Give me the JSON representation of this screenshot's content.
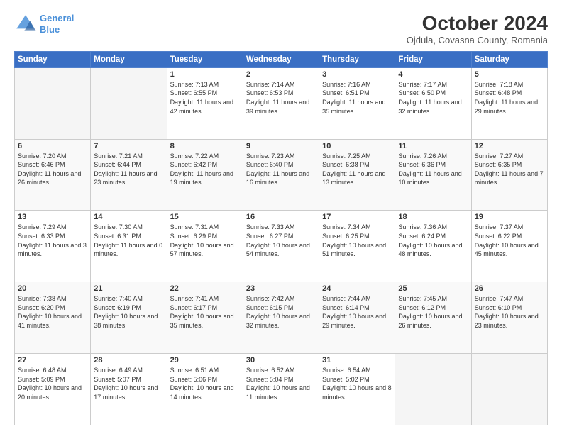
{
  "header": {
    "logo_line1": "General",
    "logo_line2": "Blue",
    "title": "October 2024",
    "subtitle": "Ojdula, Covasna County, Romania"
  },
  "days_of_week": [
    "Sunday",
    "Monday",
    "Tuesday",
    "Wednesday",
    "Thursday",
    "Friday",
    "Saturday"
  ],
  "weeks": [
    [
      {
        "day": "",
        "info": ""
      },
      {
        "day": "",
        "info": ""
      },
      {
        "day": "1",
        "info": "Sunrise: 7:13 AM\nSunset: 6:55 PM\nDaylight: 11 hours and 42 minutes."
      },
      {
        "day": "2",
        "info": "Sunrise: 7:14 AM\nSunset: 6:53 PM\nDaylight: 11 hours and 39 minutes."
      },
      {
        "day": "3",
        "info": "Sunrise: 7:16 AM\nSunset: 6:51 PM\nDaylight: 11 hours and 35 minutes."
      },
      {
        "day": "4",
        "info": "Sunrise: 7:17 AM\nSunset: 6:50 PM\nDaylight: 11 hours and 32 minutes."
      },
      {
        "day": "5",
        "info": "Sunrise: 7:18 AM\nSunset: 6:48 PM\nDaylight: 11 hours and 29 minutes."
      }
    ],
    [
      {
        "day": "6",
        "info": "Sunrise: 7:20 AM\nSunset: 6:46 PM\nDaylight: 11 hours and 26 minutes."
      },
      {
        "day": "7",
        "info": "Sunrise: 7:21 AM\nSunset: 6:44 PM\nDaylight: 11 hours and 23 minutes."
      },
      {
        "day": "8",
        "info": "Sunrise: 7:22 AM\nSunset: 6:42 PM\nDaylight: 11 hours and 19 minutes."
      },
      {
        "day": "9",
        "info": "Sunrise: 7:23 AM\nSunset: 6:40 PM\nDaylight: 11 hours and 16 minutes."
      },
      {
        "day": "10",
        "info": "Sunrise: 7:25 AM\nSunset: 6:38 PM\nDaylight: 11 hours and 13 minutes."
      },
      {
        "day": "11",
        "info": "Sunrise: 7:26 AM\nSunset: 6:36 PM\nDaylight: 11 hours and 10 minutes."
      },
      {
        "day": "12",
        "info": "Sunrise: 7:27 AM\nSunset: 6:35 PM\nDaylight: 11 hours and 7 minutes."
      }
    ],
    [
      {
        "day": "13",
        "info": "Sunrise: 7:29 AM\nSunset: 6:33 PM\nDaylight: 11 hours and 3 minutes."
      },
      {
        "day": "14",
        "info": "Sunrise: 7:30 AM\nSunset: 6:31 PM\nDaylight: 11 hours and 0 minutes."
      },
      {
        "day": "15",
        "info": "Sunrise: 7:31 AM\nSunset: 6:29 PM\nDaylight: 10 hours and 57 minutes."
      },
      {
        "day": "16",
        "info": "Sunrise: 7:33 AM\nSunset: 6:27 PM\nDaylight: 10 hours and 54 minutes."
      },
      {
        "day": "17",
        "info": "Sunrise: 7:34 AM\nSunset: 6:25 PM\nDaylight: 10 hours and 51 minutes."
      },
      {
        "day": "18",
        "info": "Sunrise: 7:36 AM\nSunset: 6:24 PM\nDaylight: 10 hours and 48 minutes."
      },
      {
        "day": "19",
        "info": "Sunrise: 7:37 AM\nSunset: 6:22 PM\nDaylight: 10 hours and 45 minutes."
      }
    ],
    [
      {
        "day": "20",
        "info": "Sunrise: 7:38 AM\nSunset: 6:20 PM\nDaylight: 10 hours and 41 minutes."
      },
      {
        "day": "21",
        "info": "Sunrise: 7:40 AM\nSunset: 6:19 PM\nDaylight: 10 hours and 38 minutes."
      },
      {
        "day": "22",
        "info": "Sunrise: 7:41 AM\nSunset: 6:17 PM\nDaylight: 10 hours and 35 minutes."
      },
      {
        "day": "23",
        "info": "Sunrise: 7:42 AM\nSunset: 6:15 PM\nDaylight: 10 hours and 32 minutes."
      },
      {
        "day": "24",
        "info": "Sunrise: 7:44 AM\nSunset: 6:14 PM\nDaylight: 10 hours and 29 minutes."
      },
      {
        "day": "25",
        "info": "Sunrise: 7:45 AM\nSunset: 6:12 PM\nDaylight: 10 hours and 26 minutes."
      },
      {
        "day": "26",
        "info": "Sunrise: 7:47 AM\nSunset: 6:10 PM\nDaylight: 10 hours and 23 minutes."
      }
    ],
    [
      {
        "day": "27",
        "info": "Sunrise: 6:48 AM\nSunset: 5:09 PM\nDaylight: 10 hours and 20 minutes."
      },
      {
        "day": "28",
        "info": "Sunrise: 6:49 AM\nSunset: 5:07 PM\nDaylight: 10 hours and 17 minutes."
      },
      {
        "day": "29",
        "info": "Sunrise: 6:51 AM\nSunset: 5:06 PM\nDaylight: 10 hours and 14 minutes."
      },
      {
        "day": "30",
        "info": "Sunrise: 6:52 AM\nSunset: 5:04 PM\nDaylight: 10 hours and 11 minutes."
      },
      {
        "day": "31",
        "info": "Sunrise: 6:54 AM\nSunset: 5:02 PM\nDaylight: 10 hours and 8 minutes."
      },
      {
        "day": "",
        "info": ""
      },
      {
        "day": "",
        "info": ""
      }
    ]
  ]
}
